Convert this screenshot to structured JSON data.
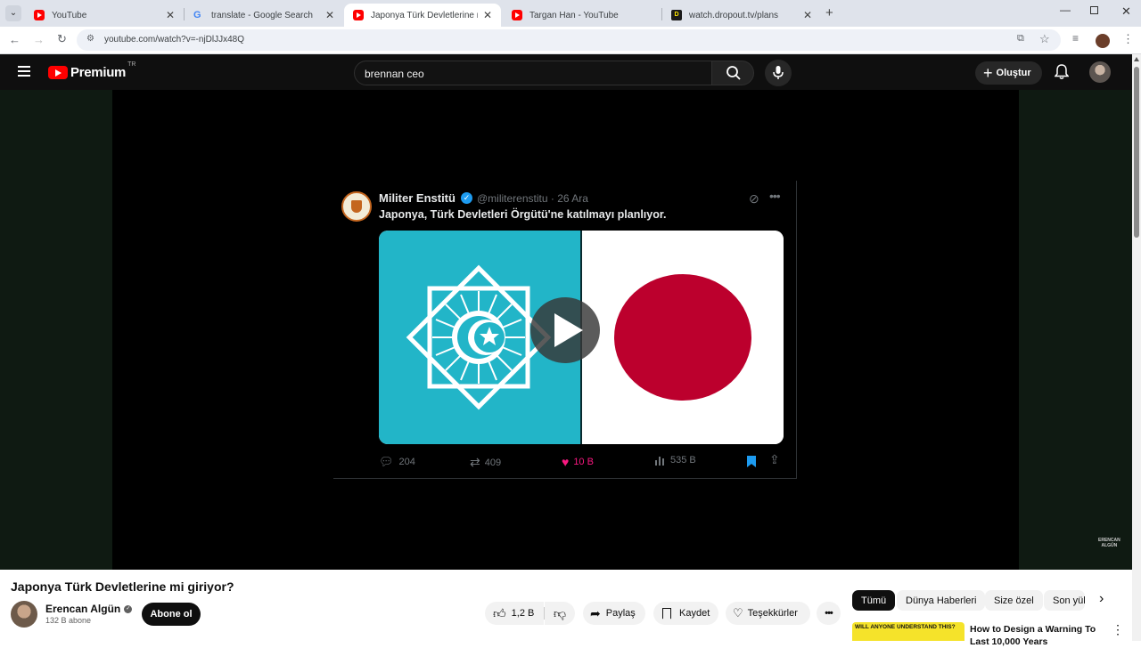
{
  "browser": {
    "tabs": [
      {
        "title": "YouTube",
        "favicon": "youtube-icon"
      },
      {
        "title": "translate - Google Search",
        "favicon": "google-icon"
      },
      {
        "title": "Japonya Türk Devletlerine mi gi",
        "favicon": "youtube-icon"
      },
      {
        "title": "Targan Han - YouTube",
        "favicon": "youtube-icon"
      },
      {
        "title": "watch.dropout.tv/plans",
        "favicon": "dropout-icon"
      }
    ],
    "url": "youtube.com/watch?v=-njDlJJx48Q"
  },
  "youtube": {
    "logo_text": "Premium",
    "logo_region": "TR",
    "search_value": "brennan ceo",
    "create_label": "Oluştur"
  },
  "tweet": {
    "author": "Militer Enstitü",
    "handle": "@militerenstitu · 26 Ara",
    "text": "Japonya, Türk Devletleri Örgütü'ne katılmayı planlıyor.",
    "replies": "204",
    "retweets": "409",
    "likes": "10 B",
    "views": "535 B"
  },
  "watermark": "ERENCAN\nALGÜN",
  "video_info": {
    "title": "Japonya Türk Devletlerine mi giriyor?",
    "channel": "Erencan Algün",
    "subscribers": "132 B abone",
    "subscribe_label": "Abone ol",
    "likes": "1,2 B",
    "share_label": "Paylaş",
    "save_label": "Kaydet",
    "thanks_label": "Teşekkürler"
  },
  "chips": [
    "Tümü",
    "Dünya Haberleri",
    "Size özel",
    "Son yük"
  ],
  "recommendation": {
    "thumb_text": "WILL ANYONE UNDERSTAND THIS?",
    "title": "How to Design a Warning To Last 10,000 Years"
  },
  "colors": {
    "yt_red": "#ff0000",
    "turkic_teal": "#22b5c8",
    "japan_red": "#bc002d",
    "like_pink": "#f91880",
    "verified_blue": "#1d9bf0"
  }
}
